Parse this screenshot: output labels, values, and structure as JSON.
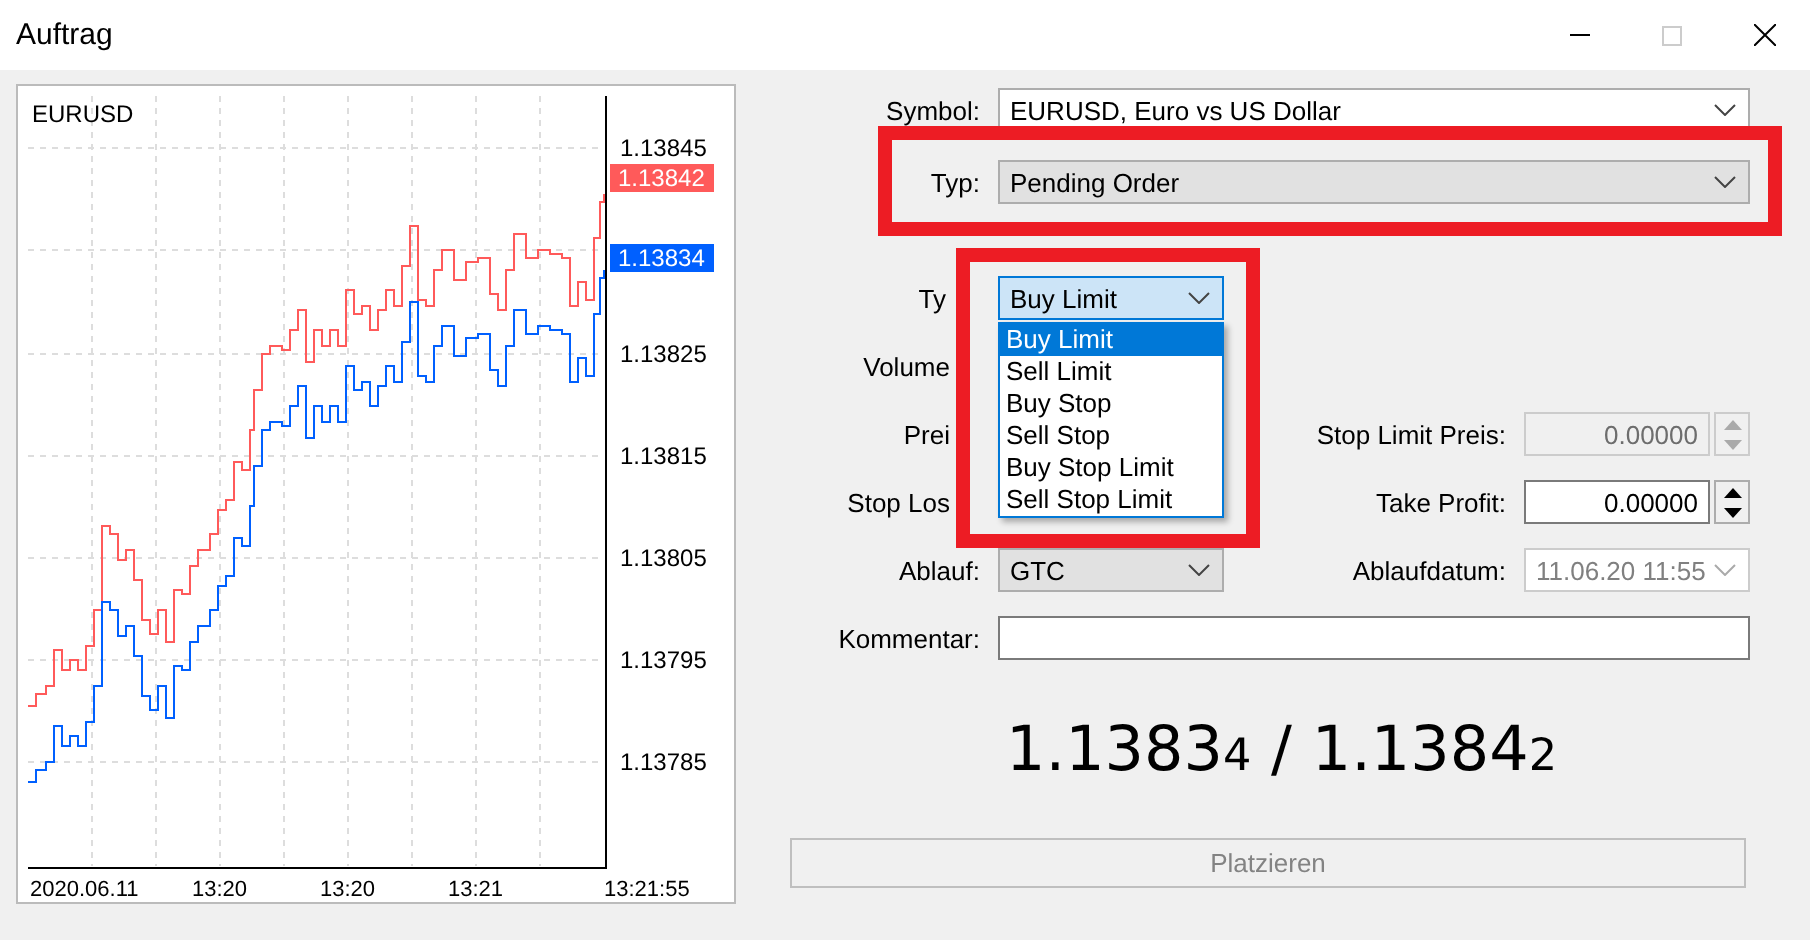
{
  "window": {
    "title": "Auftrag"
  },
  "chart": {
    "symbol": "EURUSD",
    "price_labels": [
      "1.13845",
      "1.13825",
      "1.13815",
      "1.13805",
      "1.13795",
      "1.13785"
    ],
    "ask_tag": "1.13842",
    "bid_tag": "1.13834",
    "time_labels": [
      "2020.06.11",
      "13:20",
      "13:20",
      "13:21",
      "13:21:55"
    ]
  },
  "form": {
    "symbol": {
      "label": "Symbol:",
      "value": "EURUSD, Euro vs US Dollar"
    },
    "type": {
      "label": "Typ:",
      "value": "Pending Order",
      "highlighted": true
    },
    "order_type": {
      "label": "Ty",
      "value": "Buy Limit",
      "expanded": true,
      "highlighted": true,
      "options": [
        {
          "label": "Buy Limit",
          "selected": true
        },
        {
          "label": "Sell Limit",
          "selected": false
        },
        {
          "label": "Buy Stop",
          "selected": false
        },
        {
          "label": "Sell Stop",
          "selected": false
        },
        {
          "label": "Buy Stop Limit",
          "selected": false
        },
        {
          "label": "Sell Stop Limit",
          "selected": false
        }
      ]
    },
    "partial_labels": [
      "Volume",
      "Prei",
      "Stop Los"
    ],
    "stop_limit_price": {
      "label": "Stop Limit Preis:",
      "value": "0.00000",
      "disabled": true
    },
    "take_profit": {
      "label": "Take Profit:",
      "value": "0.00000",
      "disabled": false
    },
    "expiry": {
      "label": "Ablauf:",
      "value": "GTC"
    },
    "expiry_date": {
      "label": "Ablaufdatum:",
      "value": "11.06.20 11:55",
      "disabled": true
    },
    "comment": {
      "label": "Kommentar:"
    },
    "quote": "1.1383$_{4}$ / 1.1384$_{2}$",
    "submit": {
      "label": "Platzieren",
      "disabled": true
    }
  }
}
